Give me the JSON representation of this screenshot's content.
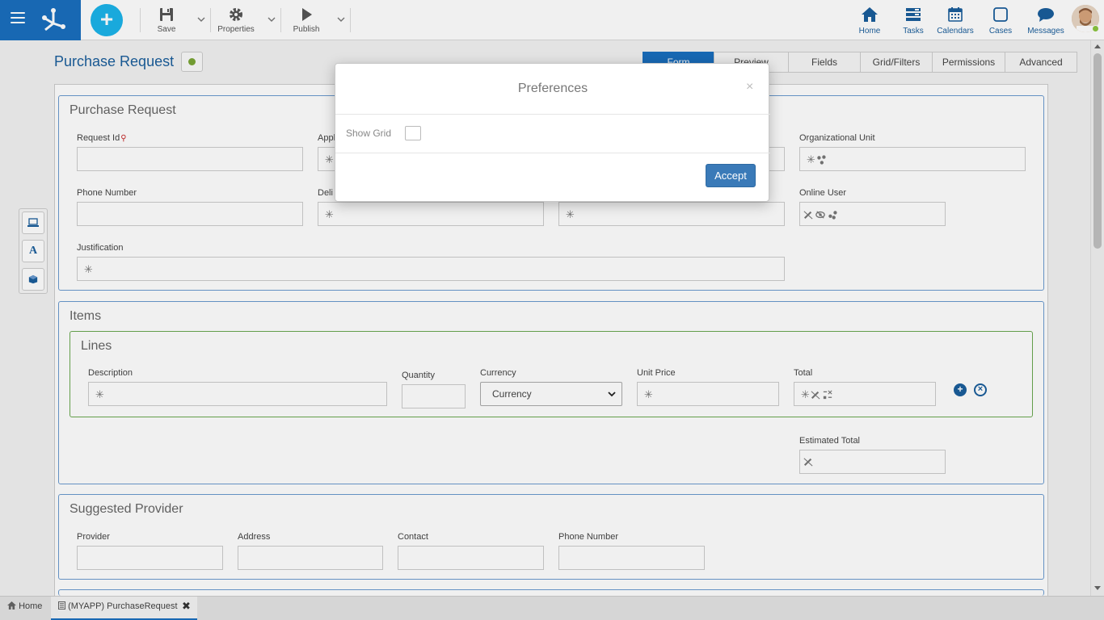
{
  "toolbar": {
    "save_label": "Save",
    "properties_label": "Properties",
    "publish_label": "Publish"
  },
  "nav": {
    "home": "Home",
    "tasks": "Tasks",
    "calendars": "Calendars",
    "cases": "Cases",
    "messages": "Messages"
  },
  "page": {
    "title": "Purchase Request",
    "tabs": [
      "Form",
      "Preview",
      "Fields",
      "Grid/Filters",
      "Permissions",
      "Advanced"
    ]
  },
  "groups": {
    "purchase_request": {
      "title": "Purchase Request",
      "fields": {
        "request_id": "Request Id",
        "applicant": "Appl",
        "organizational_unit": "Organizational Unit",
        "phone_number": "Phone Number",
        "delivery": "Deli",
        "online_user": "Online User",
        "justification": "Justification"
      }
    },
    "items": {
      "title": "Items",
      "lines": {
        "title": "Lines",
        "fields": {
          "description": "Description",
          "quantity": "Quantity",
          "currency": "Currency",
          "currency_value": "Currency",
          "unit_price": "Unit Price",
          "total": "Total"
        }
      },
      "estimated_total": "Estimated Total"
    },
    "suggested_provider": {
      "title": "Suggested Provider",
      "fields": {
        "provider": "Provider",
        "address": "Address",
        "contact": "Contact",
        "phone_number": "Phone Number"
      }
    }
  },
  "bottom_tabs": {
    "home": "Home",
    "current": "(MYAPP) PurchaseRequest"
  },
  "modal": {
    "title": "Preferences",
    "close": "×",
    "show_grid_label": "Show Grid",
    "show_grid_checked": false,
    "accept_label": "Accept"
  },
  "icons": {
    "required_mark": "✳",
    "key_mark": "⚲"
  },
  "colors": {
    "brand": "#1a6fbf",
    "add_button": "#1bb4ea",
    "accept_button": "#3a7ab8",
    "status_online": "#8cc63f"
  }
}
